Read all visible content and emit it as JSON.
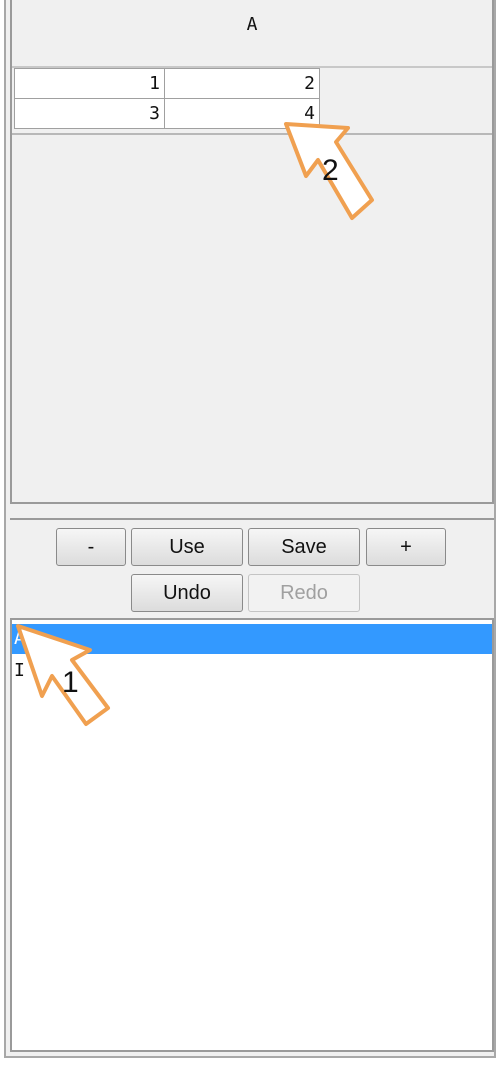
{
  "header": {
    "title": "A"
  },
  "table": {
    "rows": [
      [
        "1",
        "2"
      ],
      [
        "3",
        "4"
      ]
    ]
  },
  "toolbar": {
    "minus_label": "-",
    "use_label": "Use",
    "save_label": "Save",
    "plus_label": "+",
    "undo_label": "Undo",
    "redo_label": "Redo"
  },
  "list": {
    "items": [
      {
        "label": "A",
        "selected": true
      },
      {
        "label": "I",
        "selected": false
      }
    ]
  },
  "callouts": [
    {
      "number": "1"
    },
    {
      "number": "2"
    }
  ],
  "colors": {
    "accent": "#3399ff",
    "callout": "#f0a050",
    "panel": "#f0f0f0"
  }
}
